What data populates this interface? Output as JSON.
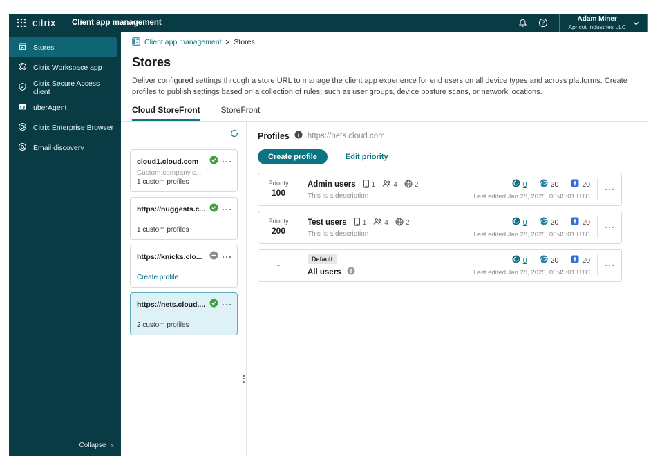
{
  "colors": {
    "topbar_bg": "#083b43",
    "nav_active_bg": "#0f6573",
    "accent": "#0c7383",
    "success_green": "#3fa142",
    "disabled_gray": "#8c8c8c",
    "selected_card_bg": "#def1f6",
    "agent_blue": "#2f6fd6",
    "browser_teal": "#2b7fa3"
  },
  "topbar": {
    "brand": "citrix",
    "divider": "|",
    "product": "Client app management",
    "user_name": "Adam Miner",
    "user_org": "Apricot Industries LLC"
  },
  "sidebar": {
    "items": [
      {
        "label": "Stores"
      },
      {
        "label": "Citrix Workspace app"
      },
      {
        "label": "Citrix Secure Access client"
      },
      {
        "label": "uberAgent"
      },
      {
        "label": "Citrix Enterprise Browser"
      },
      {
        "label": "Email discovery"
      }
    ],
    "collapse_label": "Collapse",
    "collapse_glyph": "«"
  },
  "breadcrumb": {
    "root": "Client app management",
    "separator": ">",
    "current": "Stores"
  },
  "page": {
    "title": "Stores",
    "description": "Deliver configured settings through a store URL to manage the client app experience for end users on all device types and across platforms. Create profiles to publish settings based on a collection of rules, such as user groups, device posture scans, or network locations.",
    "tabs": [
      {
        "label": "Cloud StoreFront"
      },
      {
        "label": "StoreFront"
      }
    ]
  },
  "stores_panel": {
    "cards": [
      {
        "name": "cloud1.cloud.com",
        "subtitle": "Custom.company.c...",
        "footer": "1 custom profiles",
        "status": "enabled"
      },
      {
        "name": "https://nuggests.c...",
        "subtitle": "",
        "footer": "1 custom profiles",
        "status": "enabled"
      },
      {
        "name": "https://knicks.clo...",
        "subtitle": "",
        "footer": "Create profile",
        "status": "disabled"
      },
      {
        "name": "https://nets.cloud....",
        "subtitle": "",
        "footer": "2 custom profiles",
        "status": "enabled",
        "selected": true
      }
    ]
  },
  "profiles_panel": {
    "title": "Profiles",
    "store_url": "https://nets.cloud.com",
    "create_label": "Create profile",
    "edit_priority_label": "Edit priority",
    "rows": [
      {
        "priority_label": "Priority",
        "priority": "100",
        "name": "Admin users",
        "device_count": "1",
        "user_count": "4",
        "network_count": "2",
        "description": "This is a description",
        "app_count": "0",
        "browser_count": "20",
        "agent_count": "20",
        "last_edited": "Last edited Jan 28, 2025, 05:45:01 UTC"
      },
      {
        "priority_label": "Priority",
        "priority": "200",
        "name": "Test users",
        "device_count": "1",
        "user_count": "4",
        "network_count": "2",
        "description": "This is a description",
        "app_count": "0",
        "browser_count": "20",
        "agent_count": "20",
        "last_edited": "Last edited Jan 28, 2025, 05:45:01 UTC"
      },
      {
        "priority_label": "",
        "priority": "-",
        "badge": "Default",
        "name": "All users",
        "app_count": "0",
        "browser_count": "20",
        "agent_count": "20",
        "last_edited": "Last edited Jan 28, 2025, 05:45:01 UTC"
      }
    ]
  }
}
